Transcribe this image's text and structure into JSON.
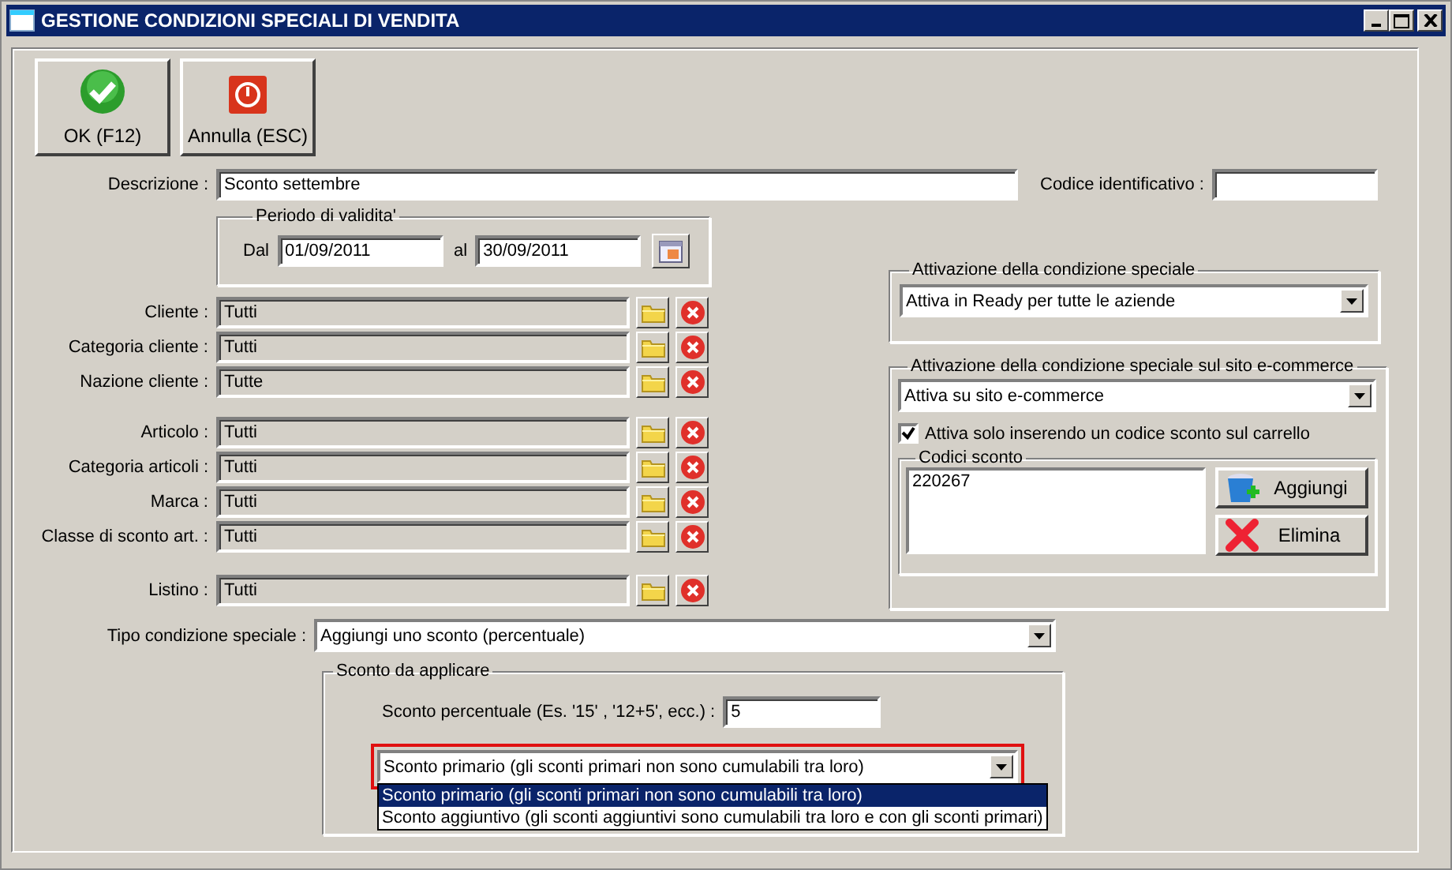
{
  "window": {
    "title": "GESTIONE CONDIZIONI SPECIALI DI VENDITA"
  },
  "toolbar": [
    {
      "kind": "ok",
      "label": "OK (F12)"
    },
    {
      "kind": "cancel",
      "label": "Annulla (ESC)"
    }
  ],
  "descrizione": {
    "label": "Descrizione :",
    "value": "Sconto settembre"
  },
  "codice": {
    "label": "Codice identificativo :"
  },
  "periodo": {
    "legend": "Periodo di validita'",
    "from_label": "Dal",
    "from": "01/09/2011",
    "to_label": "al",
    "to": "30/09/2011"
  },
  "filter_groups": [
    [
      {
        "label": "Cliente :",
        "value": "Tutti"
      },
      {
        "label": "Categoria cliente :",
        "value": "Tutti"
      },
      {
        "label": "Nazione cliente :",
        "value": "Tutte"
      }
    ],
    [
      {
        "label": "Articolo :",
        "value": "Tutti"
      },
      {
        "label": "Categoria articoli :",
        "value": "Tutti"
      },
      {
        "label": "Marca :",
        "value": "Tutti"
      },
      {
        "label": "Classe di sconto art. :",
        "value": "Tutti"
      }
    ],
    [
      {
        "label": "Listino :",
        "value": "Tutti"
      }
    ]
  ],
  "attivazione": {
    "legend": "Attivazione della condizione speciale",
    "value": "Attiva in Ready per tutte le aziende"
  },
  "ecommerce": {
    "legend": "Attivazione della condizione speciale sul sito e-commerce",
    "value": "Attiva su sito e-commerce",
    "checkbox": {
      "label": "Attiva solo inserendo un codice sconto sul carrello",
      "checked": true
    },
    "codici": {
      "legend": "Codici sconto",
      "items": [
        "220267"
      ],
      "buttons": [
        {
          "kind": "add",
          "label": "Aggiungi"
        },
        {
          "kind": "delete",
          "label": "Elimina"
        }
      ]
    }
  },
  "tipo": {
    "label": "Tipo condizione speciale :",
    "value": "Aggiungi uno sconto (percentuale)"
  },
  "sconto": {
    "legend": "Sconto da applicare",
    "percent_label": "Sconto percentuale (Es. '15' , '12+5', ecc.) :",
    "percent_value": "5",
    "type_select": {
      "value": "Sconto primario (gli sconti primari non sono cumulabili tra loro)",
      "highlighted": true
    },
    "options": [
      {
        "label": "Sconto primario (gli sconti primari non sono cumulabili tra loro)",
        "selected": true
      },
      {
        "label": "Sconto aggiuntivo (gli sconti aggiuntivi sono cumulabili tra loro e con gli sconti primari)",
        "selected": false
      }
    ]
  }
}
